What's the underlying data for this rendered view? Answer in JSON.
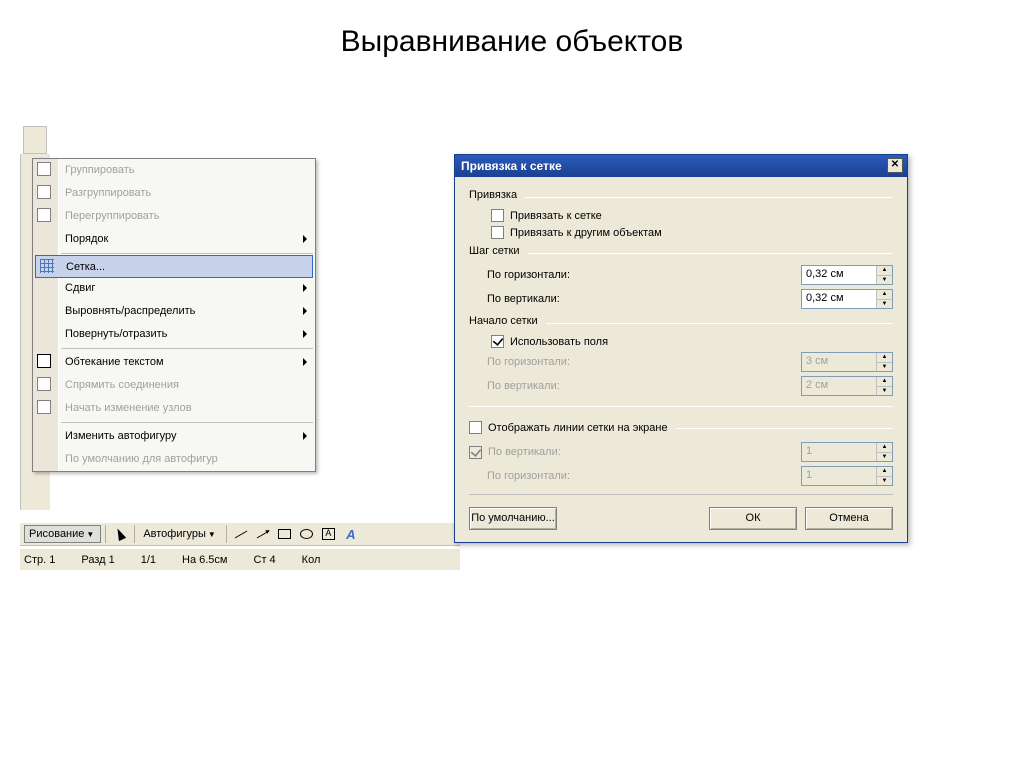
{
  "page_title": "Выравнивание объектов",
  "context_menu": {
    "items": [
      {
        "label": "Группировать",
        "disabled": true,
        "icon": "group-icon"
      },
      {
        "label": "Разгруппировать",
        "disabled": true,
        "icon": "ungroup-icon"
      },
      {
        "label": "Перегруппировать",
        "disabled": true,
        "icon": "regroup-icon"
      },
      {
        "label": "Порядок",
        "submenu": true
      },
      {
        "sep": true
      },
      {
        "label": "Сетка...",
        "highlighted": true,
        "icon": "grid-icon"
      },
      {
        "label": "Сдвиг",
        "submenu": true
      },
      {
        "label": "Выровнять/распределить",
        "submenu": true
      },
      {
        "label": "Повернуть/отразить",
        "submenu": true
      },
      {
        "sep": true
      },
      {
        "label": "Обтекание текстом",
        "submenu": true,
        "icon": "textwrap-icon"
      },
      {
        "label": "Спрямить соединения",
        "disabled": true,
        "icon": "straighten-icon"
      },
      {
        "label": "Начать изменение узлов",
        "disabled": true,
        "icon": "editpoints-icon"
      },
      {
        "sep": true
      },
      {
        "label": "Изменить автофигуру",
        "submenu": true
      },
      {
        "label": "По умолчанию для автофигур",
        "disabled": true
      }
    ]
  },
  "drawing_toolbar": {
    "drawing_label": "Рисование",
    "autoshapes_label": "Автофигуры"
  },
  "status_bar": {
    "page": "Стр. 1",
    "section": "Разд 1",
    "pages": "1/1",
    "at": "На 6.5см",
    "line": "Ст 4",
    "col": "Кол"
  },
  "dialog": {
    "title": "Привязка к сетке",
    "snap_group": "Привязка",
    "snap_to_grid": "Привязать к сетке",
    "snap_to_objects": "Привязать к другим объектам",
    "spacing_group": "Шаг сетки",
    "horizontal": "По горизонтали:",
    "vertical": "По вертикали:",
    "h_spacing_value": "0,32 см",
    "v_spacing_value": "0,32 см",
    "origin_group": "Начало сетки",
    "use_fields": "Использовать поля",
    "origin_h": "По горизонтали:",
    "origin_v": "По вертикали:",
    "origin_h_value": "3 см",
    "origin_v_value": "2 см",
    "display_gridlines": "Отображать линии сетки на экране",
    "display_v": "По вертикали:",
    "display_h": "По горизонтали:",
    "display_v_value": "1",
    "display_h_value": "1",
    "default_btn": "По умолчанию...",
    "ok_btn": "ОК",
    "cancel_btn": "Отмена"
  }
}
